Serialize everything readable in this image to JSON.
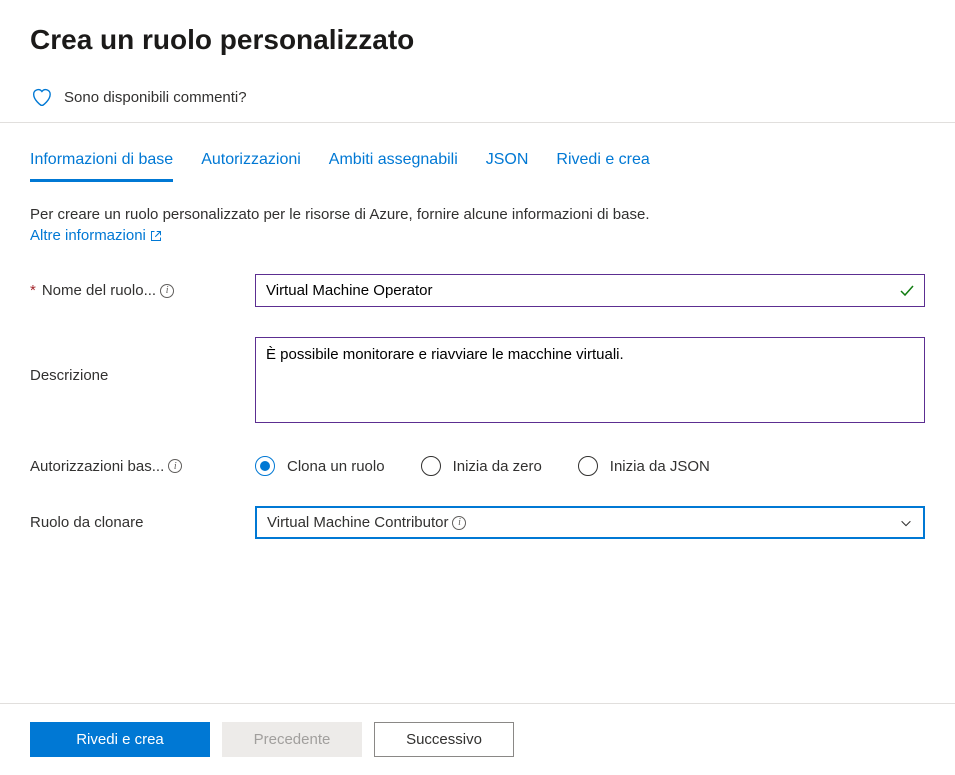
{
  "page_title": "Crea un ruolo personalizzato",
  "feedback_text": "Sono disponibili commenti?",
  "tabs": [
    {
      "label": "Informazioni di base",
      "active": true
    },
    {
      "label": "Autorizzazioni",
      "active": false
    },
    {
      "label": "Ambiti assegnabili",
      "active": false
    },
    {
      "label": "JSON",
      "active": false
    },
    {
      "label": "Rivedi e crea",
      "active": false
    }
  ],
  "intro_text": "Per creare un ruolo personalizzato per le risorse di Azure, fornire alcune informazioni di base.",
  "learn_more_text": "Altre informazioni",
  "fields": {
    "role_name_label": "Nome del ruolo...",
    "role_name_value": "Virtual Machine Operator",
    "description_label": "Descrizione",
    "description_value": "È possibile monitorare e riavviare le macchine virtuali.",
    "baseline_label": "Autorizzazioni bas...",
    "baseline_options": [
      {
        "label": "Clona un ruolo",
        "selected": true
      },
      {
        "label": "Inizia da zero",
        "selected": false
      },
      {
        "label": "Inizia da JSON",
        "selected": false
      }
    ],
    "clone_label": "Ruolo da clonare",
    "clone_value": "Virtual Machine Contributor"
  },
  "buttons": {
    "review": "Rivedi e crea",
    "previous": "Precedente",
    "next": "Successivo"
  }
}
